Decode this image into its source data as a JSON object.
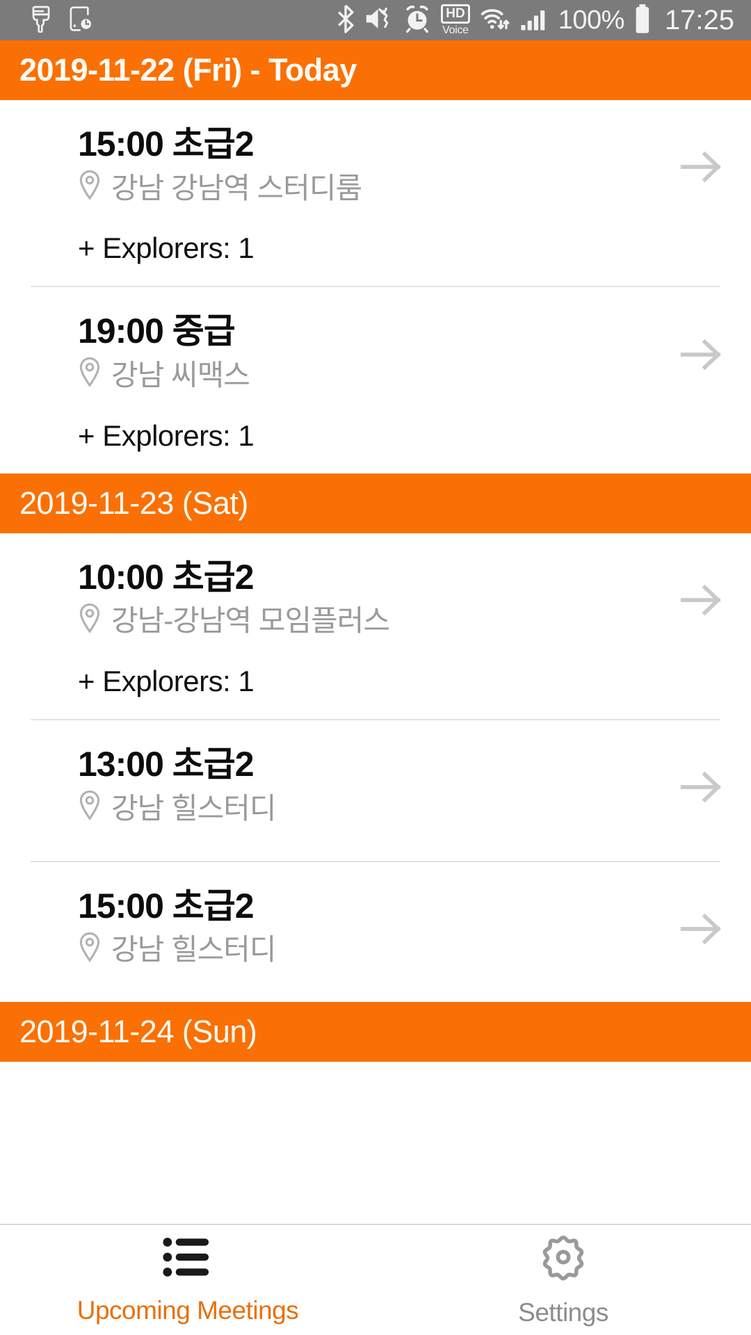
{
  "statusbar": {
    "left_icons": [
      "paintbrush-icon",
      "screen-time-icon"
    ],
    "right_icons": [
      "bluetooth-icon",
      "mute-vibrate-icon",
      "alarm-icon",
      "hd-voice-icon",
      "wifi-icon",
      "signal-icon"
    ],
    "hd_label": "HD",
    "voice_label": "Voice",
    "battery": "100%",
    "clock": "17:25"
  },
  "colors": {
    "accent_orange": "#fa7004",
    "nav_active": "#e8700a",
    "statusbar_gray": "#7b7b7b",
    "muted_text": "#9a9a9a"
  },
  "sections": [
    {
      "header": "2019-11-22 (Fri) - Today",
      "is_today": true,
      "meetings": [
        {
          "title": "15:00 초급2",
          "location": "강남 강남역 스터디룸",
          "explorers": "+ Explorers: 1",
          "arrow": "arrow-right-icon"
        },
        {
          "title": "19:00 중급",
          "location": "강남 씨맥스",
          "explorers": "+ Explorers: 1",
          "arrow": "arrow-right-icon"
        }
      ]
    },
    {
      "header": "2019-11-23 (Sat)",
      "is_today": false,
      "meetings": [
        {
          "title": "10:00 초급2",
          "location": "강남-강남역 모임플러스",
          "explorers": "+ Explorers: 1",
          "arrow": "arrow-right-icon"
        },
        {
          "title": "13:00 초급2",
          "location": "강남 힐스터디",
          "explorers": null,
          "arrow": "arrow-right-icon"
        },
        {
          "title": "15:00 초급2",
          "location": "강남 힐스터디",
          "explorers": null,
          "arrow": "arrow-right-icon"
        }
      ]
    },
    {
      "header": "2019-11-24 (Sun)",
      "is_today": false,
      "meetings": []
    }
  ],
  "bottom_nav": {
    "items": [
      {
        "label": "Upcoming Meetings",
        "icon": "list-icon",
        "active": true
      },
      {
        "label": "Settings",
        "icon": "gear-icon",
        "active": false
      }
    ]
  }
}
